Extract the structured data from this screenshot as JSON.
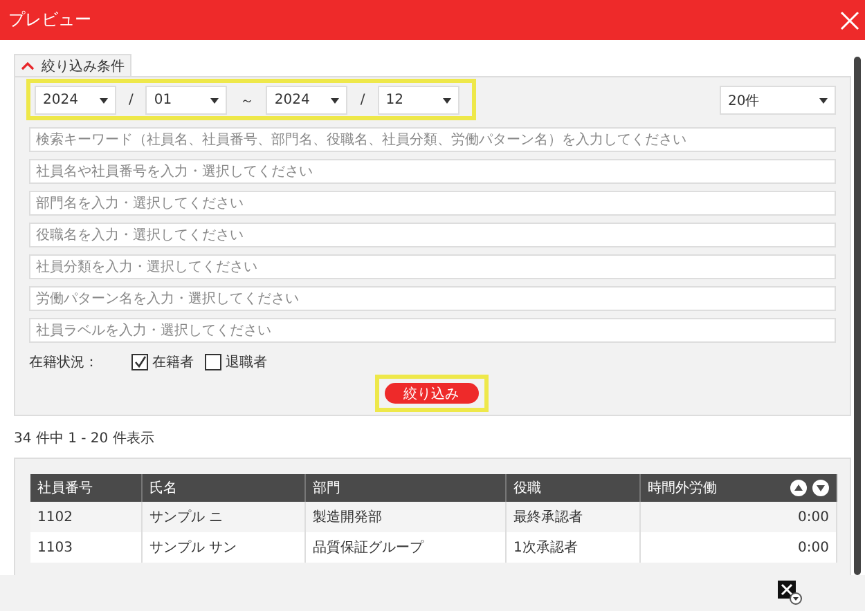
{
  "window": {
    "title": "プレビュー"
  },
  "filter_tab": {
    "label": "絞り込み条件",
    "expanded": true
  },
  "period": {
    "from_year": "2024",
    "from_month": "01",
    "separator": "～",
    "to_year": "2024",
    "to_month": "12",
    "slash": "/"
  },
  "page_size": "20件",
  "fields": [
    {
      "placeholder": "検索キーワード（社員名、社員番号、部門名、役職名、社員分類、労働パターン名）を入力してください"
    },
    {
      "placeholder": "社員名や社員番号を入力・選択してください"
    },
    {
      "placeholder": "部門名を入力・選択してください"
    },
    {
      "placeholder": "役職名を入力・選択してください"
    },
    {
      "placeholder": "社員分類を入力・選択してください"
    },
    {
      "placeholder": "労働パターン名を入力・選択してください"
    },
    {
      "placeholder": "社員ラベルを入力・選択してください"
    }
  ],
  "status": {
    "label": "在籍状況：",
    "options": [
      {
        "label": "在籍者",
        "checked": true
      },
      {
        "label": "退職者",
        "checked": false
      }
    ]
  },
  "filter_button": "絞り込み",
  "result_count": "34 件中 1 - 20 件表示",
  "table": {
    "columns": [
      "社員番号",
      "氏名",
      "部門",
      "役職",
      "時間外労働"
    ],
    "rows": [
      [
        "1102",
        "サンプル ニ",
        "製造開発部",
        "最終承認者",
        "0:00"
      ],
      [
        "1103",
        "サンプル サン",
        "品質保証グループ",
        "1次承認者",
        "0:00"
      ]
    ]
  }
}
